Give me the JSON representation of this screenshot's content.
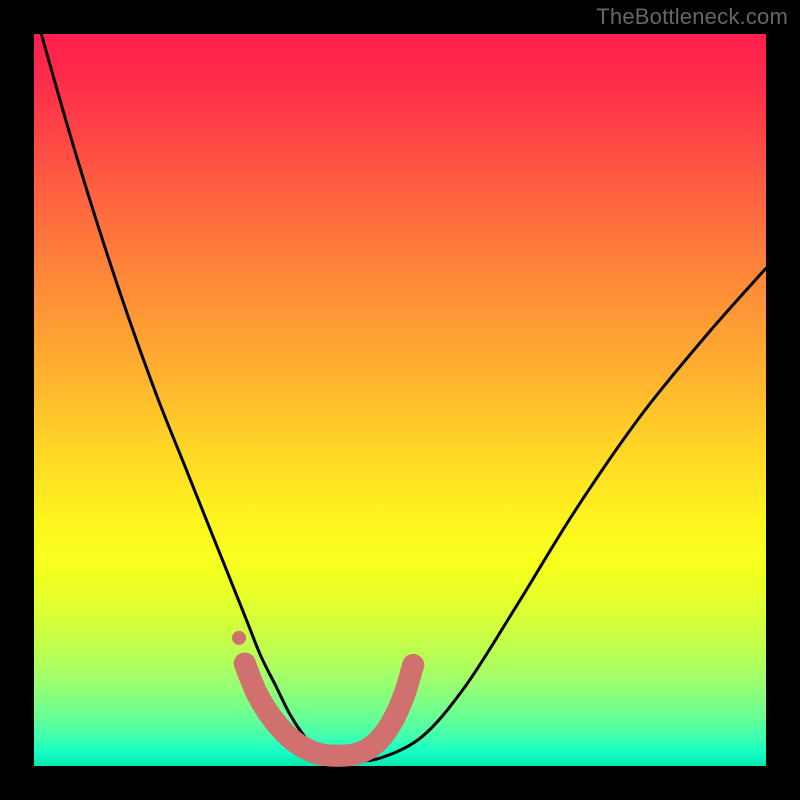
{
  "watermark": "TheBottleneck.com",
  "chart_data": {
    "type": "line",
    "title": "",
    "xlabel": "",
    "ylabel": "",
    "xlim": [
      0,
      100
    ],
    "ylim": [
      0,
      100
    ],
    "grid": false,
    "legend": false,
    "series": [
      {
        "name": "bottleneck-curve",
        "x": [
          1,
          5,
          9,
          13,
          17,
          21,
          25,
          29,
          31,
          33,
          35,
          37,
          39,
          43,
          47,
          53,
          59,
          66,
          74,
          83,
          92,
          100
        ],
        "values": [
          100,
          86,
          73,
          61,
          50,
          40,
          30,
          20,
          15,
          11,
          7,
          4,
          2,
          1,
          1,
          4,
          11,
          22,
          35,
          48,
          59,
          68
        ]
      }
    ],
    "highlight": {
      "name": "bottom-highlight",
      "color": "#d0716f",
      "points_x": [
        28.8,
        30.5,
        32.8,
        35.5,
        38.5,
        41.5,
        44.5,
        47.0,
        49.0,
        50.6,
        51.8
      ],
      "points_y": [
        14.0,
        9.8,
        6.2,
        3.4,
        1.8,
        1.4,
        1.8,
        3.4,
        6.2,
        9.8,
        13.8
      ],
      "isolated_dot": {
        "x": 28.0,
        "y": 17.5
      }
    },
    "gradient_stops": [
      {
        "pos": 0,
        "color": "#ff1f4d"
      },
      {
        "pos": 24,
        "color": "#ff6a3f"
      },
      {
        "pos": 56,
        "color": "#ffd427"
      },
      {
        "pos": 80,
        "color": "#d6ff39"
      },
      {
        "pos": 100,
        "color": "#00ebb1"
      }
    ]
  }
}
